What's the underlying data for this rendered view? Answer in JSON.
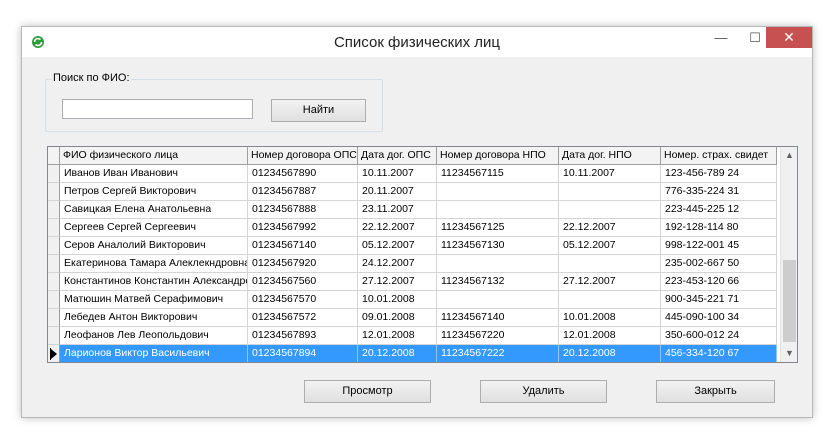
{
  "window": {
    "title": "Список физических лиц",
    "controls": {
      "minimize": "—",
      "maximize": "☐",
      "close": "✕"
    }
  },
  "search": {
    "group_label": "Поиск по ФИО:",
    "value": "",
    "placeholder": "",
    "find_label": "Найти"
  },
  "table": {
    "columns": [
      "ФИО физического лица",
      "Номер договора ОПС",
      "Дата дог. ОПС",
      "Номер договора НПО",
      "Дата дог. НПО",
      "Номер. страх. свидет"
    ],
    "rows": [
      [
        "Иванов Иван Иванович",
        "01234567890",
        "10.11.2007",
        "11234567115",
        "10.11.2007",
        "123-456-789 24"
      ],
      [
        "Петров Сергей Викторович",
        "01234567887",
        "20.11.2007",
        "",
        "",
        "776-335-224 31"
      ],
      [
        "Савицкая Елена Анатольевна",
        "01234567888",
        "23.11.2007",
        "",
        "",
        "223-445-225 12"
      ],
      [
        "Сергеев Сергей Сергеевич",
        "01234567992",
        "22.12.2007",
        "11234567125",
        "22.12.2007",
        "192-128-114 80"
      ],
      [
        "Серов Аналолий Викторович",
        "01234567140",
        "05.12.2007",
        "11234567130",
        "05.12.2007",
        "998-122-001 45"
      ],
      [
        "Екатеринова Тамара Алеклекндровна",
        "01234567920",
        "24.12.2007",
        "",
        "",
        "235-002-667 50"
      ],
      [
        "Константинов Константин Александрович",
        "01234567560",
        "27.12.2007",
        "11234567132",
        "27.12.2007",
        "223-453-120 66"
      ],
      [
        "Матюшин Матвей Серафимович",
        "01234567570",
        "10.01.2008",
        "",
        "",
        "900-345-221 71"
      ],
      [
        "Лебедев Антон Викторович",
        "01234567572",
        "09.01.2008",
        "11234567140",
        "10.01.2008",
        "445-090-100 34"
      ],
      [
        "Леофанов Лев Леопольдович",
        "01234567893",
        "12.01.2008",
        "11234567220",
        "12.01.2008",
        "350-600-012 24"
      ],
      [
        "Ларионов Виктор Васильевич",
        "01234567894",
        "20.12.2008",
        "11234567222",
        "20.12.2008",
        "456-334-120 67"
      ]
    ],
    "selected_row": 10,
    "selection_color": "#3399ff"
  },
  "footer": {
    "view_label": "Просмотр",
    "delete_label": "Удалить",
    "close_label": "Закрыть"
  }
}
